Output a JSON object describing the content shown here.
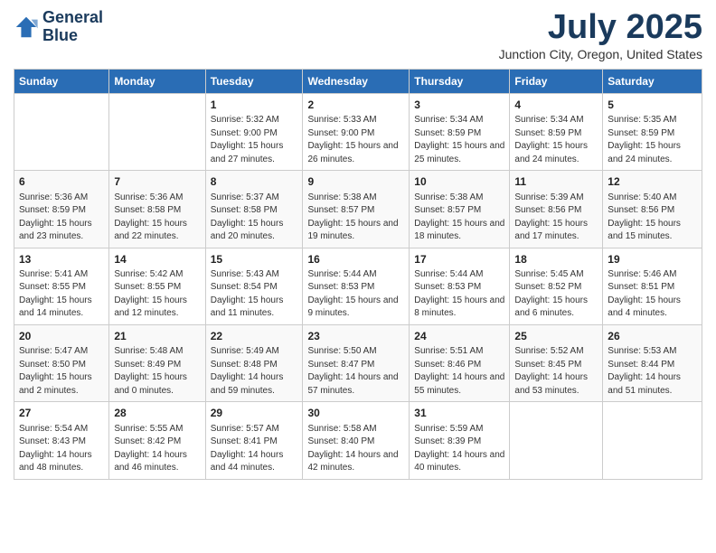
{
  "header": {
    "logo_line1": "General",
    "logo_line2": "Blue",
    "month": "July 2025",
    "location": "Junction City, Oregon, United States"
  },
  "weekdays": [
    "Sunday",
    "Monday",
    "Tuesday",
    "Wednesday",
    "Thursday",
    "Friday",
    "Saturday"
  ],
  "weeks": [
    [
      {
        "day": "",
        "sunrise": "",
        "sunset": "",
        "daylight": ""
      },
      {
        "day": "",
        "sunrise": "",
        "sunset": "",
        "daylight": ""
      },
      {
        "day": "1",
        "sunrise": "Sunrise: 5:32 AM",
        "sunset": "Sunset: 9:00 PM",
        "daylight": "Daylight: 15 hours and 27 minutes."
      },
      {
        "day": "2",
        "sunrise": "Sunrise: 5:33 AM",
        "sunset": "Sunset: 9:00 PM",
        "daylight": "Daylight: 15 hours and 26 minutes."
      },
      {
        "day": "3",
        "sunrise": "Sunrise: 5:34 AM",
        "sunset": "Sunset: 8:59 PM",
        "daylight": "Daylight: 15 hours and 25 minutes."
      },
      {
        "day": "4",
        "sunrise": "Sunrise: 5:34 AM",
        "sunset": "Sunset: 8:59 PM",
        "daylight": "Daylight: 15 hours and 24 minutes."
      },
      {
        "day": "5",
        "sunrise": "Sunrise: 5:35 AM",
        "sunset": "Sunset: 8:59 PM",
        "daylight": "Daylight: 15 hours and 24 minutes."
      }
    ],
    [
      {
        "day": "6",
        "sunrise": "Sunrise: 5:36 AM",
        "sunset": "Sunset: 8:59 PM",
        "daylight": "Daylight: 15 hours and 23 minutes."
      },
      {
        "day": "7",
        "sunrise": "Sunrise: 5:36 AM",
        "sunset": "Sunset: 8:58 PM",
        "daylight": "Daylight: 15 hours and 22 minutes."
      },
      {
        "day": "8",
        "sunrise": "Sunrise: 5:37 AM",
        "sunset": "Sunset: 8:58 PM",
        "daylight": "Daylight: 15 hours and 20 minutes."
      },
      {
        "day": "9",
        "sunrise": "Sunrise: 5:38 AM",
        "sunset": "Sunset: 8:57 PM",
        "daylight": "Daylight: 15 hours and 19 minutes."
      },
      {
        "day": "10",
        "sunrise": "Sunrise: 5:38 AM",
        "sunset": "Sunset: 8:57 PM",
        "daylight": "Daylight: 15 hours and 18 minutes."
      },
      {
        "day": "11",
        "sunrise": "Sunrise: 5:39 AM",
        "sunset": "Sunset: 8:56 PM",
        "daylight": "Daylight: 15 hours and 17 minutes."
      },
      {
        "day": "12",
        "sunrise": "Sunrise: 5:40 AM",
        "sunset": "Sunset: 8:56 PM",
        "daylight": "Daylight: 15 hours and 15 minutes."
      }
    ],
    [
      {
        "day": "13",
        "sunrise": "Sunrise: 5:41 AM",
        "sunset": "Sunset: 8:55 PM",
        "daylight": "Daylight: 15 hours and 14 minutes."
      },
      {
        "day": "14",
        "sunrise": "Sunrise: 5:42 AM",
        "sunset": "Sunset: 8:55 PM",
        "daylight": "Daylight: 15 hours and 12 minutes."
      },
      {
        "day": "15",
        "sunrise": "Sunrise: 5:43 AM",
        "sunset": "Sunset: 8:54 PM",
        "daylight": "Daylight: 15 hours and 11 minutes."
      },
      {
        "day": "16",
        "sunrise": "Sunrise: 5:44 AM",
        "sunset": "Sunset: 8:53 PM",
        "daylight": "Daylight: 15 hours and 9 minutes."
      },
      {
        "day": "17",
        "sunrise": "Sunrise: 5:44 AM",
        "sunset": "Sunset: 8:53 PM",
        "daylight": "Daylight: 15 hours and 8 minutes."
      },
      {
        "day": "18",
        "sunrise": "Sunrise: 5:45 AM",
        "sunset": "Sunset: 8:52 PM",
        "daylight": "Daylight: 15 hours and 6 minutes."
      },
      {
        "day": "19",
        "sunrise": "Sunrise: 5:46 AM",
        "sunset": "Sunset: 8:51 PM",
        "daylight": "Daylight: 15 hours and 4 minutes."
      }
    ],
    [
      {
        "day": "20",
        "sunrise": "Sunrise: 5:47 AM",
        "sunset": "Sunset: 8:50 PM",
        "daylight": "Daylight: 15 hours and 2 minutes."
      },
      {
        "day": "21",
        "sunrise": "Sunrise: 5:48 AM",
        "sunset": "Sunset: 8:49 PM",
        "daylight": "Daylight: 15 hours and 0 minutes."
      },
      {
        "day": "22",
        "sunrise": "Sunrise: 5:49 AM",
        "sunset": "Sunset: 8:48 PM",
        "daylight": "Daylight: 14 hours and 59 minutes."
      },
      {
        "day": "23",
        "sunrise": "Sunrise: 5:50 AM",
        "sunset": "Sunset: 8:47 PM",
        "daylight": "Daylight: 14 hours and 57 minutes."
      },
      {
        "day": "24",
        "sunrise": "Sunrise: 5:51 AM",
        "sunset": "Sunset: 8:46 PM",
        "daylight": "Daylight: 14 hours and 55 minutes."
      },
      {
        "day": "25",
        "sunrise": "Sunrise: 5:52 AM",
        "sunset": "Sunset: 8:45 PM",
        "daylight": "Daylight: 14 hours and 53 minutes."
      },
      {
        "day": "26",
        "sunrise": "Sunrise: 5:53 AM",
        "sunset": "Sunset: 8:44 PM",
        "daylight": "Daylight: 14 hours and 51 minutes."
      }
    ],
    [
      {
        "day": "27",
        "sunrise": "Sunrise: 5:54 AM",
        "sunset": "Sunset: 8:43 PM",
        "daylight": "Daylight: 14 hours and 48 minutes."
      },
      {
        "day": "28",
        "sunrise": "Sunrise: 5:55 AM",
        "sunset": "Sunset: 8:42 PM",
        "daylight": "Daylight: 14 hours and 46 minutes."
      },
      {
        "day": "29",
        "sunrise": "Sunrise: 5:57 AM",
        "sunset": "Sunset: 8:41 PM",
        "daylight": "Daylight: 14 hours and 44 minutes."
      },
      {
        "day": "30",
        "sunrise": "Sunrise: 5:58 AM",
        "sunset": "Sunset: 8:40 PM",
        "daylight": "Daylight: 14 hours and 42 minutes."
      },
      {
        "day": "31",
        "sunrise": "Sunrise: 5:59 AM",
        "sunset": "Sunset: 8:39 PM",
        "daylight": "Daylight: 14 hours and 40 minutes."
      },
      {
        "day": "",
        "sunrise": "",
        "sunset": "",
        "daylight": ""
      },
      {
        "day": "",
        "sunrise": "",
        "sunset": "",
        "daylight": ""
      }
    ]
  ]
}
